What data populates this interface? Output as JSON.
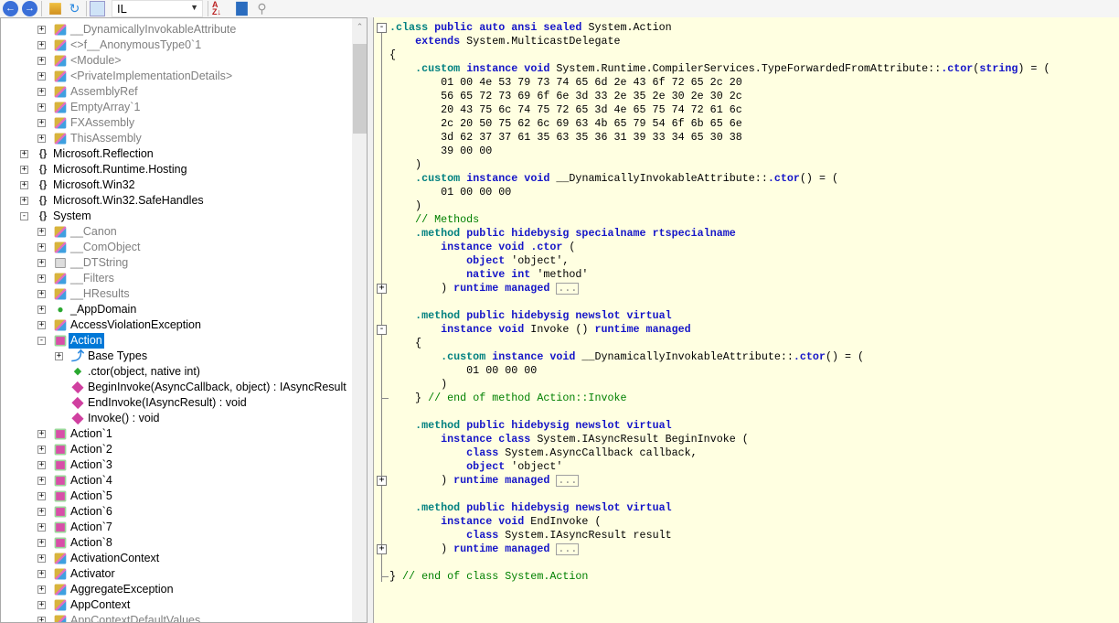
{
  "toolbar": {
    "language": "IL",
    "buttons": [
      "back",
      "forward",
      "open",
      "refresh",
      "show-internal",
      "sort",
      "browse",
      "search"
    ]
  },
  "tree": [
    {
      "level": 2,
      "label": "__DynamicallyInvokableAttribute",
      "icon": "class",
      "exp": "+",
      "gray": true
    },
    {
      "level": 2,
      "label": "<>f__AnonymousType0`1",
      "icon": "class",
      "exp": "+",
      "gray": true
    },
    {
      "level": 2,
      "label": "<Module>",
      "icon": "class",
      "exp": "+",
      "gray": true
    },
    {
      "level": 2,
      "label": "<PrivateImplementationDetails>",
      "icon": "class",
      "exp": "+",
      "gray": true
    },
    {
      "level": 2,
      "label": "AssemblyRef",
      "icon": "class",
      "exp": "+",
      "gray": true
    },
    {
      "level": 2,
      "label": "EmptyArray`1",
      "icon": "class",
      "exp": "+",
      "gray": true
    },
    {
      "level": 2,
      "label": "FXAssembly",
      "icon": "class",
      "exp": "+",
      "gray": true
    },
    {
      "level": 2,
      "label": "ThisAssembly",
      "icon": "class",
      "exp": "+",
      "gray": true
    },
    {
      "level": 1,
      "label": "Microsoft.Reflection",
      "icon": "ns",
      "exp": "+"
    },
    {
      "level": 1,
      "label": "Microsoft.Runtime.Hosting",
      "icon": "ns",
      "exp": "+"
    },
    {
      "level": 1,
      "label": "Microsoft.Win32",
      "icon": "ns",
      "exp": "+"
    },
    {
      "level": 1,
      "label": "Microsoft.Win32.SafeHandles",
      "icon": "ns",
      "exp": "+"
    },
    {
      "level": 1,
      "label": "System",
      "icon": "ns",
      "exp": "-"
    },
    {
      "level": 2,
      "label": "__Canon",
      "icon": "class",
      "exp": "+",
      "gray": true
    },
    {
      "level": 2,
      "label": "__ComObject",
      "icon": "class",
      "exp": "+",
      "gray": true
    },
    {
      "level": 2,
      "label": "__DTString",
      "icon": "struct",
      "exp": "+",
      "gray": true
    },
    {
      "level": 2,
      "label": "__Filters",
      "icon": "class",
      "exp": "+",
      "gray": true
    },
    {
      "level": 2,
      "label": "__HResults",
      "icon": "class",
      "exp": "+",
      "gray": true
    },
    {
      "level": 2,
      "label": "_AppDomain",
      "icon": "interface",
      "exp": "+"
    },
    {
      "level": 2,
      "label": "AccessViolationException",
      "icon": "class",
      "exp": "+"
    },
    {
      "level": 2,
      "label": "Action",
      "icon": "delegate",
      "exp": "-",
      "selected": true
    },
    {
      "level": 3,
      "label": "Base Types",
      "icon": "base",
      "exp": "+"
    },
    {
      "level": 3,
      "label": ".ctor(object, native int)",
      "icon": "ctor"
    },
    {
      "level": 3,
      "label": "BeginInvoke(AsyncCallback, object) : IAsyncResult",
      "icon": "method"
    },
    {
      "level": 3,
      "label": "EndInvoke(IAsyncResult) : void",
      "icon": "method"
    },
    {
      "level": 3,
      "label": "Invoke() : void",
      "icon": "method"
    },
    {
      "level": 2,
      "label": "Action`1",
      "icon": "delegate",
      "exp": "+"
    },
    {
      "level": 2,
      "label": "Action`2",
      "icon": "delegate",
      "exp": "+"
    },
    {
      "level": 2,
      "label": "Action`3",
      "icon": "delegate",
      "exp": "+"
    },
    {
      "level": 2,
      "label": "Action`4",
      "icon": "delegate",
      "exp": "+"
    },
    {
      "level": 2,
      "label": "Action`5",
      "icon": "delegate",
      "exp": "+"
    },
    {
      "level": 2,
      "label": "Action`6",
      "icon": "delegate",
      "exp": "+"
    },
    {
      "level": 2,
      "label": "Action`7",
      "icon": "delegate",
      "exp": "+"
    },
    {
      "level": 2,
      "label": "Action`8",
      "icon": "delegate",
      "exp": "+"
    },
    {
      "level": 2,
      "label": "ActivationContext",
      "icon": "class",
      "exp": "+"
    },
    {
      "level": 2,
      "label": "Activator",
      "icon": "class",
      "exp": "+"
    },
    {
      "level": 2,
      "label": "AggregateException",
      "icon": "class",
      "exp": "+"
    },
    {
      "level": 2,
      "label": "AppContext",
      "icon": "class",
      "exp": "+"
    },
    {
      "level": 2,
      "label": "AppContextDefaultValues",
      "icon": "class",
      "exp": "+",
      "gray": true
    }
  ],
  "code": [
    [
      [
        "d",
        ".class"
      ],
      [
        "t",
        " "
      ],
      [
        "k",
        "public auto ansi sealed"
      ],
      [
        "t",
        " System.Action"
      ]
    ],
    [
      [
        "t",
        "    "
      ],
      [
        "k",
        "extends"
      ],
      [
        "t",
        " System.MulticastDelegate"
      ]
    ],
    [
      [
        "t",
        "{"
      ]
    ],
    [
      [
        "t",
        "    "
      ],
      [
        "d",
        ".custom"
      ],
      [
        "t",
        " "
      ],
      [
        "k",
        "instance void"
      ],
      [
        "t",
        " System.Runtime.CompilerServices.TypeForwardedFromAttribute::"
      ],
      [
        "k",
        ".ctor"
      ],
      [
        "t",
        "("
      ],
      [
        "k",
        "string"
      ],
      [
        "t",
        ") = ("
      ]
    ],
    [
      [
        "t",
        "        01 00 4e 53 79 73 74 65 6d 2e 43 6f 72 65 2c 20"
      ]
    ],
    [
      [
        "t",
        "        56 65 72 73 69 6f 6e 3d 33 2e 35 2e 30 2e 30 2c"
      ]
    ],
    [
      [
        "t",
        "        20 43 75 6c 74 75 72 65 3d 4e 65 75 74 72 61 6c"
      ]
    ],
    [
      [
        "t",
        "        2c 20 50 75 62 6c 69 63 4b 65 79 54 6f 6b 65 6e"
      ]
    ],
    [
      [
        "t",
        "        3d 62 37 37 61 35 63 35 36 31 39 33 34 65 30 38"
      ]
    ],
    [
      [
        "t",
        "        39 00 00"
      ]
    ],
    [
      [
        "t",
        "    )"
      ]
    ],
    [
      [
        "t",
        "    "
      ],
      [
        "d",
        ".custom"
      ],
      [
        "t",
        " "
      ],
      [
        "k",
        "instance void"
      ],
      [
        "t",
        " __DynamicallyInvokableAttribute::"
      ],
      [
        "k",
        ".ctor"
      ],
      [
        "t",
        "() = ("
      ]
    ],
    [
      [
        "t",
        "        01 00 00 00"
      ]
    ],
    [
      [
        "t",
        "    )"
      ]
    ],
    [
      [
        "t",
        "    "
      ],
      [
        "c",
        "// Methods"
      ]
    ],
    [
      [
        "t",
        "    "
      ],
      [
        "d",
        ".method"
      ],
      [
        "t",
        " "
      ],
      [
        "k",
        "public hidebysig specialname rtspecialname"
      ]
    ],
    [
      [
        "t",
        "        "
      ],
      [
        "k",
        "instance void"
      ],
      [
        "t",
        " "
      ],
      [
        "k",
        ".ctor"
      ],
      [
        "t",
        " ("
      ]
    ],
    [
      [
        "t",
        "            "
      ],
      [
        "k",
        "object"
      ],
      [
        "t",
        " 'object',"
      ]
    ],
    [
      [
        "t",
        "            "
      ],
      [
        "k",
        "native int"
      ],
      [
        "t",
        " 'method'"
      ]
    ],
    [
      [
        "t",
        "        ) "
      ],
      [
        "k",
        "runtime managed"
      ],
      [
        "t",
        " "
      ],
      [
        "m",
        "..."
      ]
    ],
    [],
    [
      [
        "t",
        "    "
      ],
      [
        "d",
        ".method"
      ],
      [
        "t",
        " "
      ],
      [
        "k",
        "public hidebysig newslot virtual"
      ]
    ],
    [
      [
        "t",
        "        "
      ],
      [
        "k",
        "instance void"
      ],
      [
        "t",
        " Invoke () "
      ],
      [
        "k",
        "runtime managed"
      ]
    ],
    [
      [
        "t",
        "    {"
      ]
    ],
    [
      [
        "t",
        "        "
      ],
      [
        "d",
        ".custom"
      ],
      [
        "t",
        " "
      ],
      [
        "k",
        "instance void"
      ],
      [
        "t",
        " __DynamicallyInvokableAttribute::"
      ],
      [
        "k",
        ".ctor"
      ],
      [
        "t",
        "() = ("
      ]
    ],
    [
      [
        "t",
        "            01 00 00 00"
      ]
    ],
    [
      [
        "t",
        "        )"
      ]
    ],
    [
      [
        "t",
        "    } "
      ],
      [
        "c",
        "// end of method Action::Invoke"
      ]
    ],
    [],
    [
      [
        "t",
        "    "
      ],
      [
        "d",
        ".method"
      ],
      [
        "t",
        " "
      ],
      [
        "k",
        "public hidebysig newslot virtual"
      ]
    ],
    [
      [
        "t",
        "        "
      ],
      [
        "k",
        "instance class"
      ],
      [
        "t",
        " System.IAsyncResult BeginInvoke ("
      ]
    ],
    [
      [
        "t",
        "            "
      ],
      [
        "k",
        "class"
      ],
      [
        "t",
        " System.AsyncCallback callback,"
      ]
    ],
    [
      [
        "t",
        "            "
      ],
      [
        "k",
        "object"
      ],
      [
        "t",
        " 'object'"
      ]
    ],
    [
      [
        "t",
        "        ) "
      ],
      [
        "k",
        "runtime managed"
      ],
      [
        "t",
        " "
      ],
      [
        "m",
        "..."
      ]
    ],
    [],
    [
      [
        "t",
        "    "
      ],
      [
        "d",
        ".method"
      ],
      [
        "t",
        " "
      ],
      [
        "k",
        "public hidebysig newslot virtual"
      ]
    ],
    [
      [
        "t",
        "        "
      ],
      [
        "k",
        "instance void"
      ],
      [
        "t",
        " EndInvoke ("
      ]
    ],
    [
      [
        "t",
        "            "
      ],
      [
        "k",
        "class"
      ],
      [
        "t",
        " System.IAsyncResult result"
      ]
    ],
    [
      [
        "t",
        "        ) "
      ],
      [
        "k",
        "runtime managed"
      ],
      [
        "t",
        " "
      ],
      [
        "m",
        "..."
      ]
    ],
    [],
    [
      [
        "t",
        "} "
      ],
      [
        "c",
        "// end of class System.Action"
      ]
    ]
  ],
  "folds": [
    {
      "line": 0,
      "sign": "-"
    },
    {
      "line": 19,
      "sign": "+"
    },
    {
      "line": 22,
      "sign": "-"
    },
    {
      "line": 33,
      "sign": "+"
    },
    {
      "line": 38,
      "sign": "+"
    }
  ],
  "colors": {
    "keyword": "#1515c8",
    "directive": "#008080",
    "comment": "#008000",
    "selection": "#0078d7",
    "editor_bg": "#ffffe1"
  }
}
